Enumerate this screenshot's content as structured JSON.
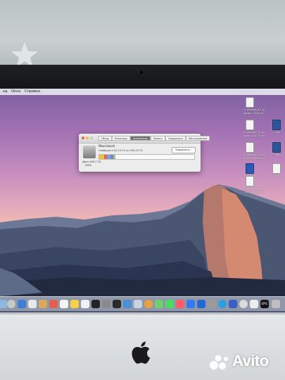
{
  "menubar": {
    "items": [
      "од",
      "Окно",
      "Справка"
    ]
  },
  "dialog": {
    "tabs": [
      "Обзор",
      "Мониторы",
      "Хранилище",
      "Память",
      "Поддержка",
      "Обслуживание"
    ],
    "active_tab_index": 2,
    "drive_name": "Macintosh",
    "free_space": "Свободно 433,15 ГБ из 499,25 ГБ",
    "manage_button": "Управлять...",
    "drive_caption_line1": "Диск 499,2 ГБ",
    "drive_caption_line2": "SATA",
    "usage_segments": [
      {
        "color": "#f1c232",
        "fraction": 0.05
      },
      {
        "color": "#e06666",
        "fraction": 0.03
      },
      {
        "color": "#6fa8dc",
        "fraction": 0.04
      },
      {
        "color": "#8e7cc3",
        "fraction": 0.03
      },
      {
        "color": "#93c47d",
        "fraction": 0.02
      }
    ],
    "used_fraction": 0.13
  },
  "desktop_items": [
    {
      "label": "ru_windows_8.1_pr",
      "label2": "ofessio...2328.iso",
      "style": "doc"
    },
    {
      "label": "ru_windows_10_bu",
      "label2": "siness_21H...33.iso",
      "style": "doc"
    },
    {
      "label": "ru_windows_10_mu",
      "label2": "lti_21H...8b2e.iso",
      "style": "doc"
    },
    {
      "label": "...doc",
      "label2": "",
      "style": "word"
    },
    {
      "label": "...docx",
      "label2": "",
      "style": "word"
    },
    {
      "label": "Инсталляция",
      "label2": "",
      "style": "blue"
    },
    {
      "label": "Ускорить...",
      "label2": "",
      "style": "doc"
    },
    {
      "label": "Windows_arena_",
      "label2": "...ntegrity_ru...iso",
      "style": "doc"
    }
  ],
  "dock": {
    "badge": "EPIC"
  },
  "brand": {
    "apple": "apple-logo",
    "watermark": "Avito"
  }
}
